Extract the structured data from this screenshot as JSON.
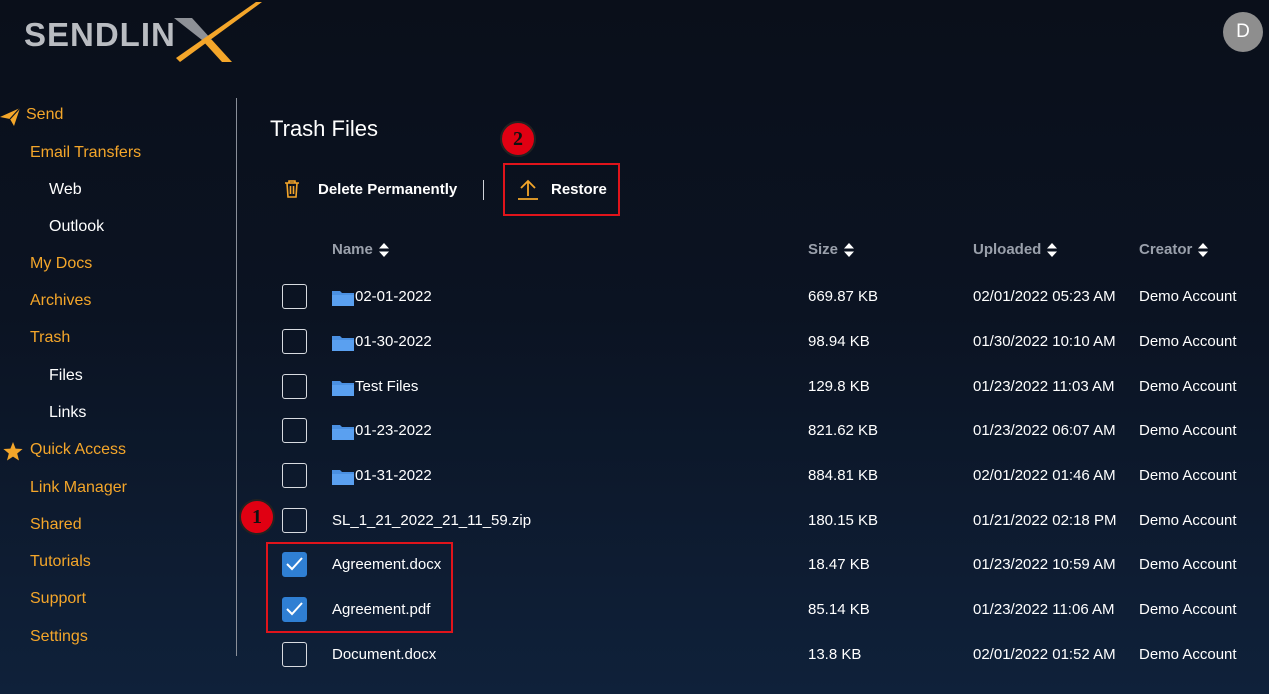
{
  "brand": {
    "name": "SENDLIN"
  },
  "user": {
    "avatar_initial": "D"
  },
  "sidebar": {
    "items": [
      {
        "label": "Send",
        "type": "main",
        "icon": "paper-plane-icon"
      },
      {
        "label": "Email Transfers",
        "type": "section"
      },
      {
        "label": "Web",
        "type": "sub"
      },
      {
        "label": "Outlook",
        "type": "sub"
      },
      {
        "label": "My Docs",
        "type": "section"
      },
      {
        "label": "Archives",
        "type": "section"
      },
      {
        "label": "Trash",
        "type": "section"
      },
      {
        "label": "Files",
        "type": "sub"
      },
      {
        "label": "Links",
        "type": "sub"
      },
      {
        "label": "Quick Access",
        "type": "main",
        "icon": "star-icon"
      },
      {
        "label": "Link Manager",
        "type": "section"
      },
      {
        "label": "Shared",
        "type": "section"
      },
      {
        "label": "Tutorials",
        "type": "section"
      },
      {
        "label": "Support",
        "type": "section"
      },
      {
        "label": "Settings",
        "type": "section"
      }
    ]
  },
  "main": {
    "title": "Trash Files",
    "toolbar": {
      "delete_label": "Delete Permanently",
      "restore_label": "Restore"
    },
    "annotations": {
      "step1": "1",
      "step2": "2"
    },
    "columns": {
      "name": "Name",
      "size": "Size",
      "uploaded": "Uploaded",
      "creator": "Creator"
    },
    "rows": [
      {
        "name": "02-01-2022",
        "is_folder": true,
        "size": "669.87 KB",
        "uploaded": "02/01/2022 05:23 AM",
        "creator": "Demo Account",
        "checked": false
      },
      {
        "name": "01-30-2022",
        "is_folder": true,
        "size": "98.94 KB",
        "uploaded": "01/30/2022 10:10 AM",
        "creator": "Demo Account",
        "checked": false
      },
      {
        "name": "Test Files",
        "is_folder": true,
        "size": "129.8 KB",
        "uploaded": "01/23/2022 11:03 AM",
        "creator": "Demo Account",
        "checked": false
      },
      {
        "name": "01-23-2022",
        "is_folder": true,
        "size": "821.62 KB",
        "uploaded": "01/23/2022 06:07 AM",
        "creator": "Demo Account",
        "checked": false
      },
      {
        "name": "01-31-2022",
        "is_folder": true,
        "size": "884.81 KB",
        "uploaded": "02/01/2022 01:46 AM",
        "creator": "Demo Account",
        "checked": false
      },
      {
        "name": "SL_1_21_2022_21_11_59.zip",
        "is_folder": false,
        "size": "180.15 KB",
        "uploaded": "01/21/2022 02:18 PM",
        "creator": "Demo Account",
        "checked": false
      },
      {
        "name": "Agreement.docx",
        "is_folder": false,
        "size": "18.47 KB",
        "uploaded": "01/23/2022 10:59 AM",
        "creator": "Demo Account",
        "checked": true
      },
      {
        "name": "Agreement.pdf",
        "is_folder": false,
        "size": "85.14 KB",
        "uploaded": "01/23/2022 11:06 AM",
        "creator": "Demo Account",
        "checked": true
      },
      {
        "name": "Document.docx",
        "is_folder": false,
        "size": "13.8 KB",
        "uploaded": "02/01/2022 01:52 AM",
        "creator": "Demo Account",
        "checked": false
      }
    ]
  },
  "colors": {
    "accent": "#f4a62a",
    "checkbox_checked": "#2f7fd3",
    "folder": "#4a90e2",
    "highlight": "#e0141b"
  }
}
